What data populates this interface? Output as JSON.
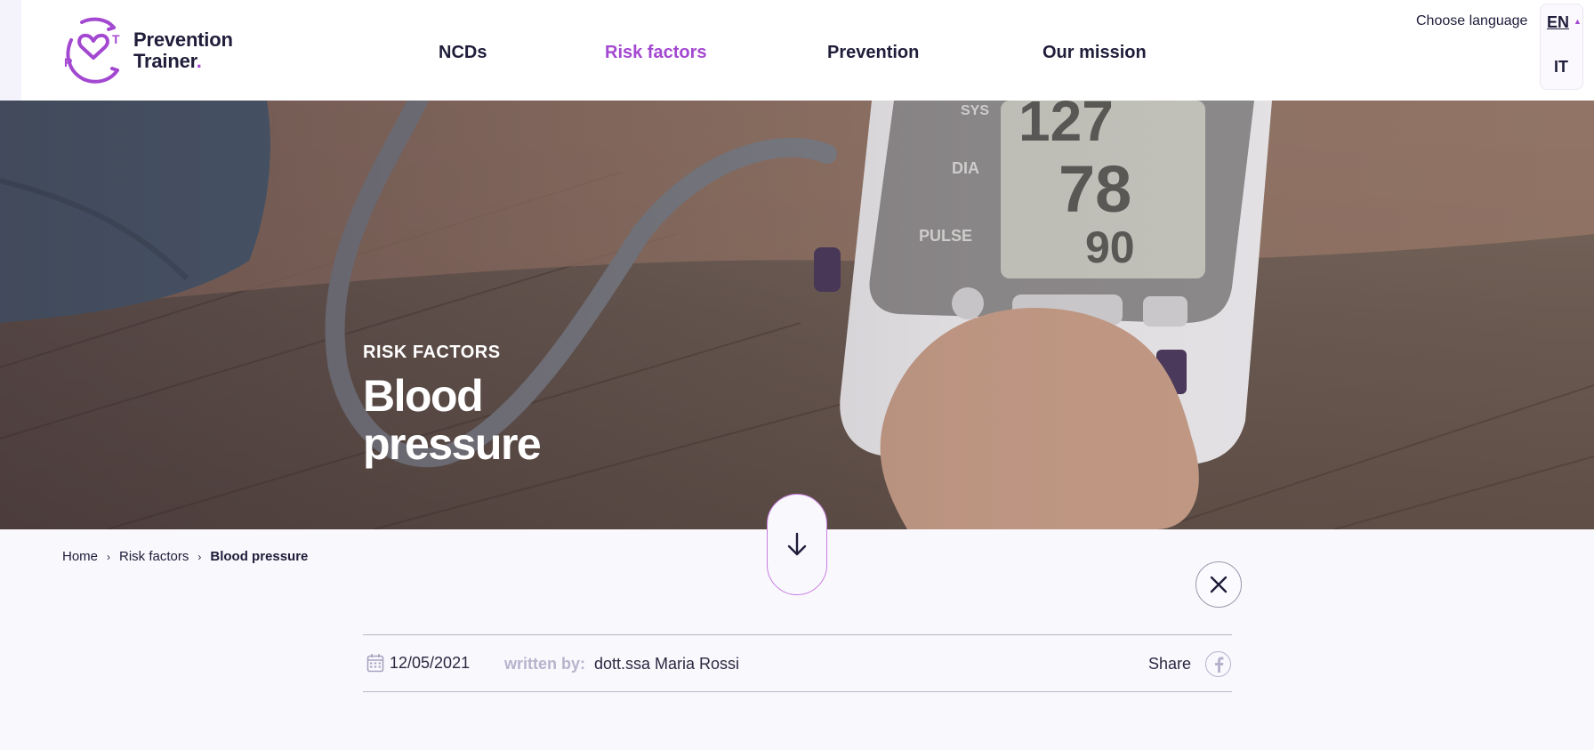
{
  "brand": {
    "name_line1": "Prevention",
    "name_line2": "Trainer",
    "name_dot": ".",
    "logo_icon": "heart-in-hands-icon",
    "accent_color": "#a348d1"
  },
  "nav": {
    "items": [
      {
        "label": "NCDs",
        "active": false
      },
      {
        "label": "Risk factors",
        "active": true
      },
      {
        "label": "Prevention",
        "active": false
      },
      {
        "label": "Our mission",
        "active": false
      }
    ]
  },
  "language": {
    "label": "Choose language",
    "current": "EN",
    "options": [
      "EN",
      "IT"
    ]
  },
  "hero": {
    "kicker": "RISK FACTORS",
    "title": "Blood pressure"
  },
  "scroll_button": {
    "icon": "arrow-down-icon"
  },
  "breadcrumb": {
    "items": [
      "Home",
      "Risk factors",
      "Blood pressure"
    ],
    "separator": "›"
  },
  "close_button": {
    "icon": "close-icon"
  },
  "meta": {
    "date": "12/05/2021",
    "author_label": "written by:",
    "author": "dott.ssa Maria Rossi",
    "share_label": "Share",
    "share_icon": "facebook-icon"
  }
}
